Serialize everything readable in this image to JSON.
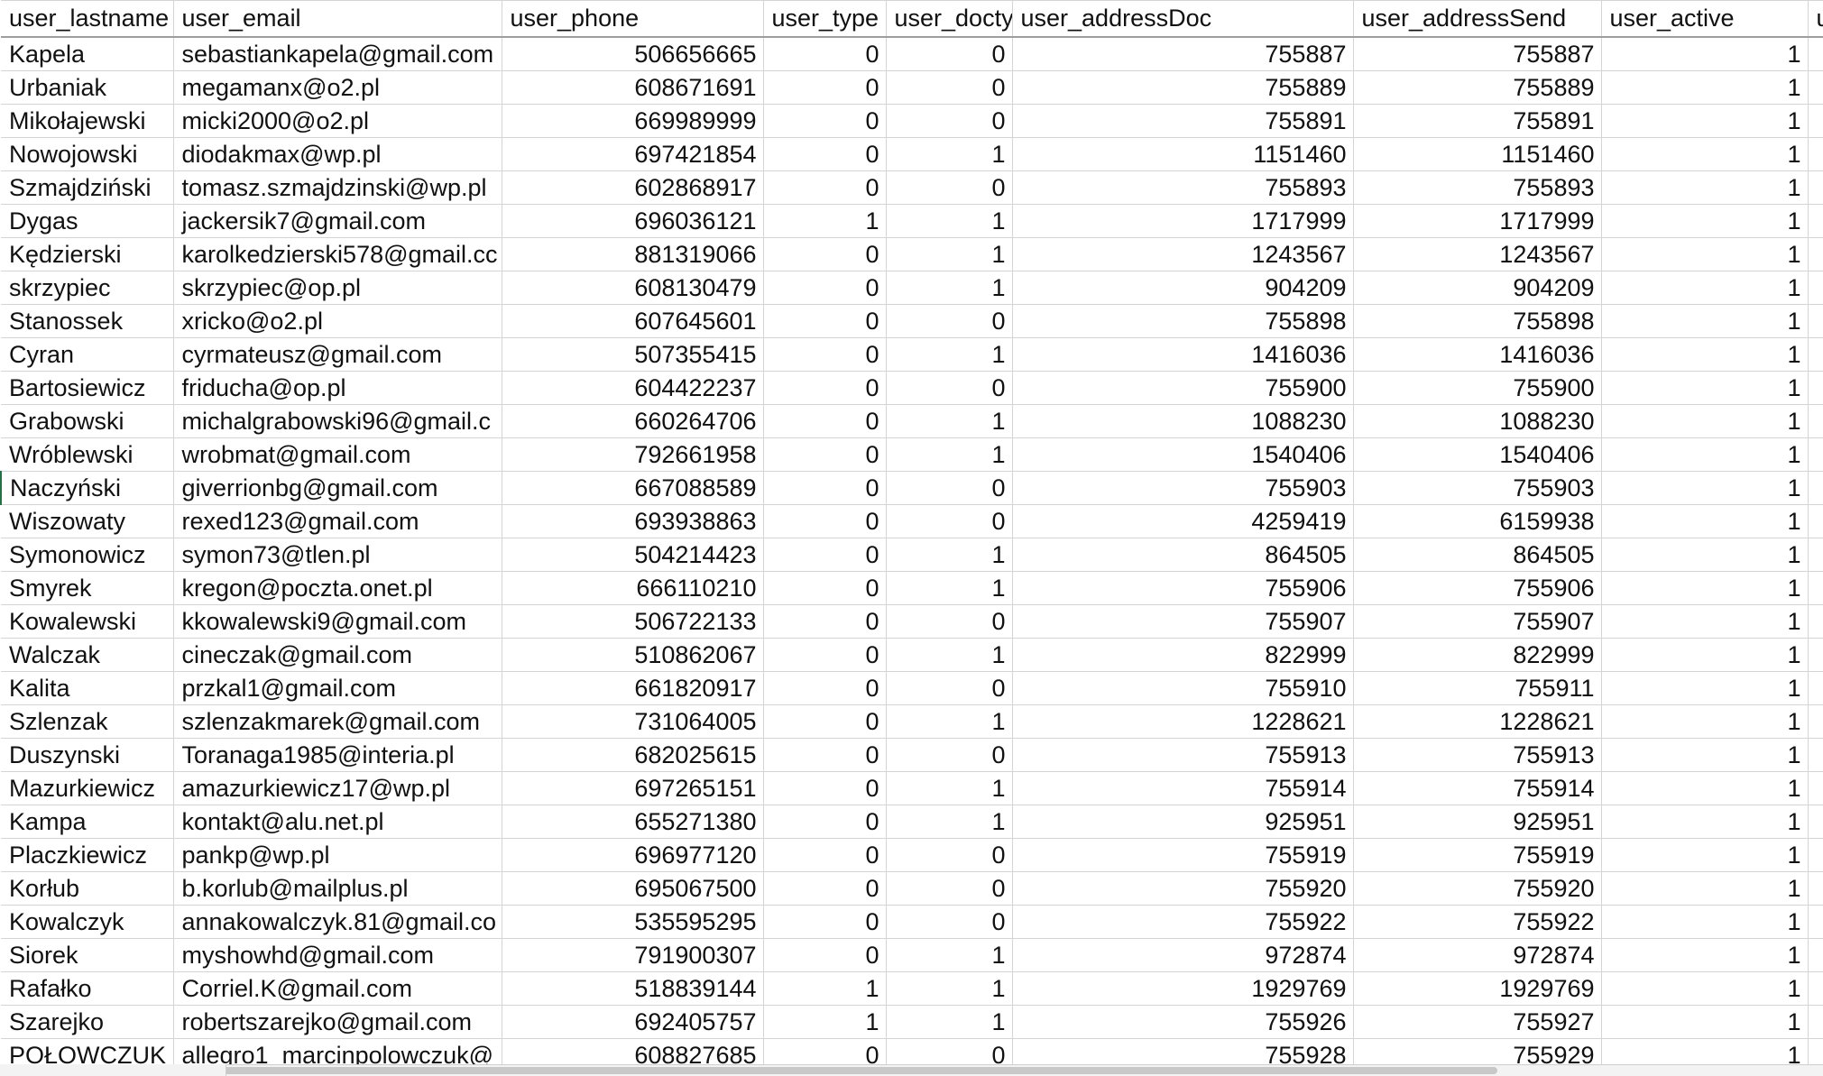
{
  "columns": [
    "user_lastname",
    "user_email",
    "user_phone",
    "user_type",
    "user_docty",
    "user_addressDoc",
    "user_addressSend",
    "user_active",
    "u"
  ],
  "rows": [
    [
      "Kapela",
      "sebastiankapela@gmail.com",
      "506656665",
      "0",
      "0",
      "755887",
      "755887",
      "1"
    ],
    [
      "Urbaniak",
      "megamanx@o2.pl",
      "608671691",
      "0",
      "0",
      "755889",
      "755889",
      "1"
    ],
    [
      "Mikołajewski",
      "micki2000@o2.pl",
      "669989999",
      "0",
      "0",
      "755891",
      "755891",
      "1"
    ],
    [
      "Nowojowski",
      "diodakmax@wp.pl",
      "697421854",
      "0",
      "1",
      "1151460",
      "1151460",
      "1"
    ],
    [
      "Szmajdziński",
      "tomasz.szmajdzinski@wp.pl",
      "602868917",
      "0",
      "0",
      "755893",
      "755893",
      "1"
    ],
    [
      "Dygas",
      "jackersik7@gmail.com",
      "696036121",
      "1",
      "1",
      "1717999",
      "1717999",
      "1"
    ],
    [
      "Kędzierski",
      "karolkedzierski578@gmail.cc",
      "881319066",
      "0",
      "1",
      "1243567",
      "1243567",
      "1"
    ],
    [
      "skrzypiec",
      "skrzypiec@op.pl",
      "608130479",
      "0",
      "1",
      "904209",
      "904209",
      "1"
    ],
    [
      "Stanossek",
      "xricko@o2.pl",
      "607645601",
      "0",
      "0",
      "755898",
      "755898",
      "1"
    ],
    [
      "Cyran",
      "cyrmateusz@gmail.com",
      "507355415",
      "0",
      "1",
      "1416036",
      "1416036",
      "1"
    ],
    [
      "Bartosiewicz",
      "friducha@op.pl",
      "604422237",
      "0",
      "0",
      "755900",
      "755900",
      "1"
    ],
    [
      "Grabowski",
      "michalgrabowski96@gmail.c",
      "660264706",
      "0",
      "1",
      "1088230",
      "1088230",
      "1"
    ],
    [
      "Wróblewski",
      "wrobmat@gmail.com",
      "792661958",
      "0",
      "1",
      "1540406",
      "1540406",
      "1"
    ],
    [
      "Naczyński",
      "giverrionbg@gmail.com",
      "667088589",
      "0",
      "0",
      "755903",
      "755903",
      "1"
    ],
    [
      "Wiszowaty",
      "rexed123@gmail.com",
      "693938863",
      "0",
      "0",
      "4259419",
      "6159938",
      "1"
    ],
    [
      "Symonowicz",
      "symon73@tlen.pl",
      "504214423",
      "0",
      "1",
      "864505",
      "864505",
      "1"
    ],
    [
      "Smyrek",
      "kregon@poczta.onet.pl",
      "666110210",
      "0",
      "1",
      "755906",
      "755906",
      "1"
    ],
    [
      "Kowalewski",
      "kkowalewski9@gmail.com",
      "506722133",
      "0",
      "0",
      "755907",
      "755907",
      "1"
    ],
    [
      "Walczak",
      "cineczak@gmail.com",
      "510862067",
      "0",
      "1",
      "822999",
      "822999",
      "1"
    ],
    [
      "Kalita",
      "przkal1@gmail.com",
      "661820917",
      "0",
      "0",
      "755910",
      "755911",
      "1"
    ],
    [
      "Szlenzak",
      "szlenzakmarek@gmail.com",
      "731064005",
      "0",
      "1",
      "1228621",
      "1228621",
      "1"
    ],
    [
      "Duszynski",
      "Toranaga1985@interia.pl",
      "682025615",
      "0",
      "0",
      "755913",
      "755913",
      "1"
    ],
    [
      "Mazurkiewicz",
      "amazurkiewicz17@wp.pl",
      "697265151",
      "0",
      "1",
      "755914",
      "755914",
      "1"
    ],
    [
      "Kampa",
      "kontakt@alu.net.pl",
      "655271380",
      "0",
      "1",
      "925951",
      "925951",
      "1"
    ],
    [
      "Placzkiewicz",
      "pankp@wp.pl",
      "696977120",
      "0",
      "0",
      "755919",
      "755919",
      "1"
    ],
    [
      "Korłub",
      "b.korlub@mailplus.pl",
      "695067500",
      "0",
      "0",
      "755920",
      "755920",
      "1"
    ],
    [
      "Kowalczyk",
      "annakowalczyk.81@gmail.co",
      "535595295",
      "0",
      "0",
      "755922",
      "755922",
      "1"
    ],
    [
      "Siorek",
      "myshowhd@gmail.com",
      "791900307",
      "0",
      "1",
      "972874",
      "972874",
      "1"
    ],
    [
      "Rafałko",
      "Corriel.K@gmail.com",
      "518839144",
      "1",
      "1",
      "1929769",
      "1929769",
      "1"
    ],
    [
      "Szarejko",
      "robertszarejko@gmail.com",
      "692405757",
      "1",
      "1",
      "755926",
      "755927",
      "1"
    ],
    [
      "POŁOWCZUK",
      "allegro1_marcinpolowczuk@",
      "608827685",
      "0",
      "0",
      "755928",
      "755929",
      "1"
    ]
  ],
  "selected_row_index": 13,
  "colors": {
    "grid": "#d4d4d4",
    "header_border": "#9e9e9e",
    "selection": "#217346"
  }
}
